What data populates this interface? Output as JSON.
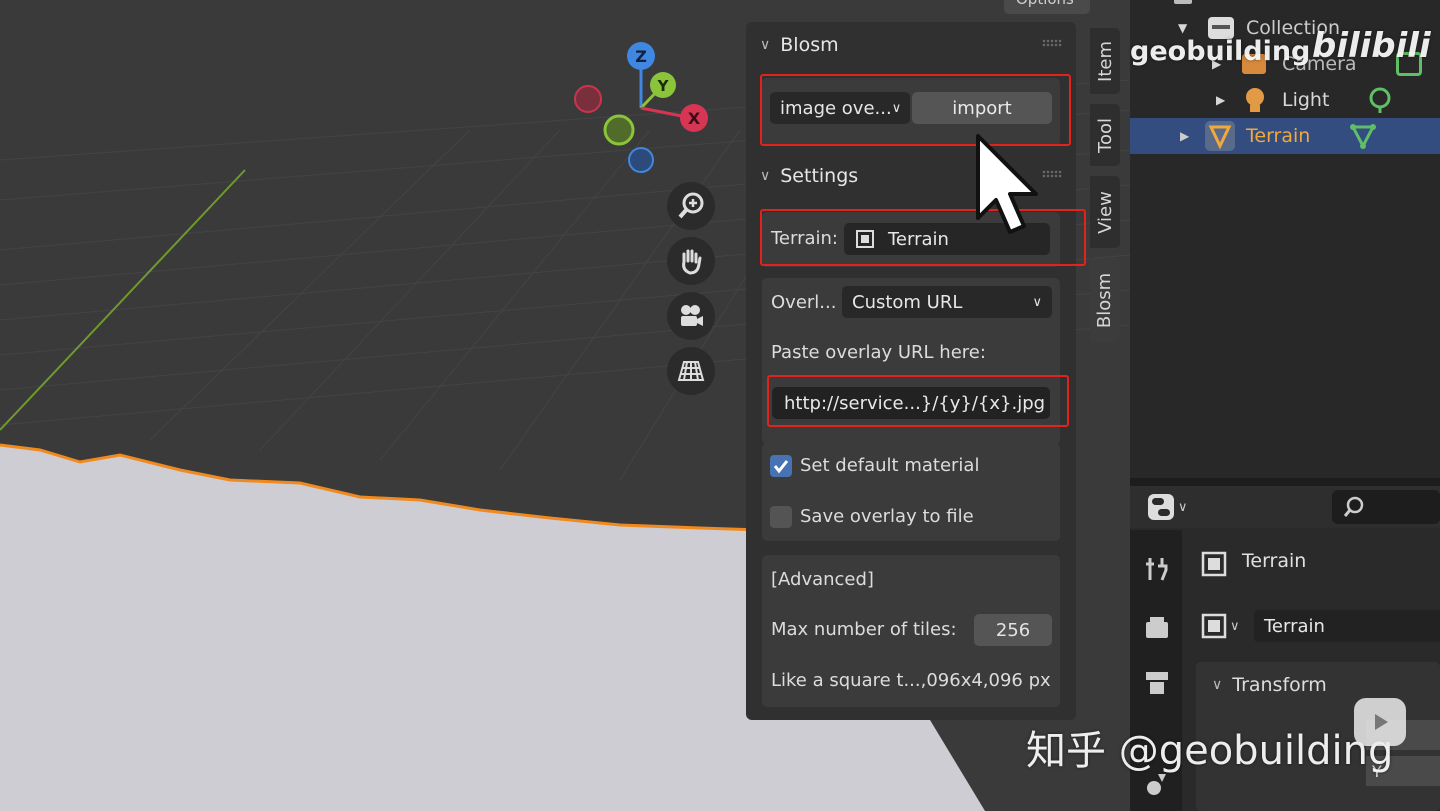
{
  "viewport": {
    "options_label": "Options",
    "gizmo": {
      "z": "Z",
      "y": "Y",
      "x": "X"
    },
    "nav_icons": [
      "zoom-icon",
      "hand-pan-icon",
      "camera-icon",
      "grid-ortho-icon"
    ]
  },
  "sidebar_tabs": [
    "Item",
    "Tool",
    "View",
    "Blosm"
  ],
  "blosm_panel": {
    "title": "Blosm",
    "mode_dropdown": "image ove...",
    "import_button": "import",
    "settings_title": "Settings",
    "terrain_label": "Terrain:",
    "terrain_value": "Terrain",
    "overlay_label": "Overl...",
    "overlay_value": "Custom URL",
    "paste_label": "Paste overlay URL here:",
    "url_value": "http://service...}/{y}/{x}.jpg",
    "set_default_material": {
      "label": "Set default material",
      "checked": true
    },
    "save_overlay": {
      "label": "Save overlay to file",
      "checked": false
    },
    "advanced_label": "[Advanced]",
    "max_tiles_label": "Max number of tiles:",
    "max_tiles_value": "256",
    "info_text": "Like a square t...,096x4,096 px"
  },
  "outliner": {
    "items": [
      {
        "label": "Collection",
        "icon": "collection-icon"
      },
      {
        "label": "Camera",
        "icon": "camera-object-icon"
      },
      {
        "label": "Light",
        "icon": "light-icon"
      },
      {
        "label": "Terrain",
        "icon": "mesh-icon",
        "selected": true
      }
    ]
  },
  "properties": {
    "object_name": "Terrain",
    "mesh_name": "Terrain",
    "section": "Transform",
    "y_label": "Y"
  },
  "watermarks": {
    "channel": "geobuilding",
    "site": "bilibili",
    "zhihu": "知乎 @geobuilding"
  },
  "colors": {
    "accent_blue": "#4772b3",
    "highlight_red": "#e2221d",
    "selection_orange": "#f0a93c",
    "axis_x": "#d63653",
    "axis_y": "#8bc33a",
    "axis_z": "#3f87e0"
  }
}
